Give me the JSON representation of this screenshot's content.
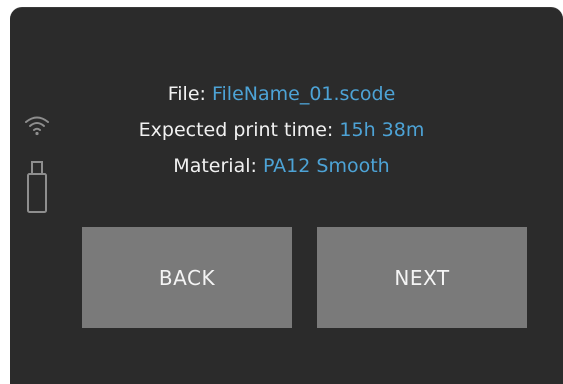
{
  "print_summary": {
    "file_label": "File:",
    "file_value": "FileName_01.scode",
    "time_label": "Expected print time:",
    "time_value": "15h 38m",
    "material_label": "Material:",
    "material_value": "PA12 Smooth"
  },
  "buttons": {
    "back_label": "BACK",
    "next_label": "NEXT"
  },
  "status_icons": {
    "wifi": "wifi-icon",
    "usb": "usb-drive-icon"
  },
  "colors": {
    "screen_background": "#2b2b2b",
    "value_accent": "#4da3d6",
    "button_background": "#7a7a7a"
  }
}
